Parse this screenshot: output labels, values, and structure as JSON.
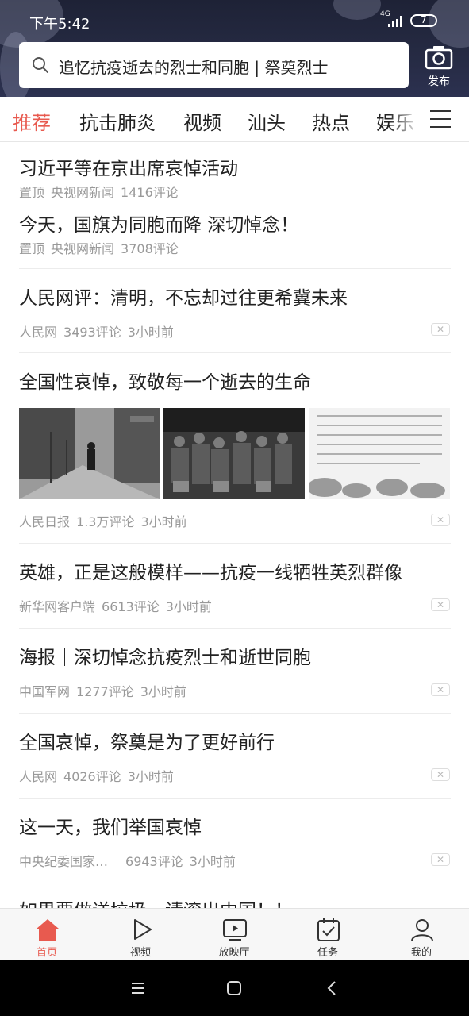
{
  "status_bar": {
    "time": "下午5:42",
    "network": "4G",
    "battery": "7"
  },
  "search": {
    "text": "追忆抗疫逝去的烈士和同胞 | 祭奠烈士",
    "publish_label": "发布"
  },
  "tabs": [
    {
      "label": "推荐",
      "active": true
    },
    {
      "label": "抗击肺炎",
      "active": false
    },
    {
      "label": "视频",
      "active": false
    },
    {
      "label": "汕头",
      "active": false
    },
    {
      "label": "热点",
      "active": false
    },
    {
      "label": "娱乐",
      "active": false
    }
  ],
  "pinned": [
    {
      "title": "习近平等在京出席哀悼活动",
      "tag": "置顶",
      "source": "央视网新闻",
      "comments": "1416评论"
    },
    {
      "title": "今天，国旗为同胞而降 深切悼念！",
      "tag": "置顶",
      "source": "央视网新闻",
      "comments": "3708评论"
    }
  ],
  "feed": [
    {
      "title": "人民网评：清明，不忘却过往更希冀未来",
      "source": "人民网",
      "comments": "3493评论",
      "time": "3小时前"
    },
    {
      "title": "全国性哀悼，致敬每一个逝去的生命",
      "source": "人民日报",
      "comments": "1.3万评论",
      "time": "3小时前"
    },
    {
      "title": "英雄，正是这般模样——抗疫一线牺牲英烈群像",
      "source": "新华网客户端",
      "comments": "6613评论",
      "time": "3小时前"
    },
    {
      "title": "海报｜深切悼念抗疫烈士和逝世同胞",
      "source": "中国军网",
      "comments": "1277评论",
      "time": "3小时前"
    },
    {
      "title": "全国哀悼，祭奠是为了更好前行",
      "source": "人民网",
      "comments": "4026评论",
      "time": "3小时前"
    },
    {
      "title": "这一天，我们举国哀悼",
      "source": "中央纪委国家…",
      "comments": "6943评论",
      "time": "3小时前"
    },
    {
      "title": "如果要做送垃圾，请滚出中国！！"
    }
  ],
  "bottom_nav": [
    {
      "label": "首页",
      "icon": "home-icon",
      "active": true
    },
    {
      "label": "视频",
      "icon": "play-icon",
      "active": false
    },
    {
      "label": "放映厅",
      "icon": "tv-icon",
      "active": false
    },
    {
      "label": "任务",
      "icon": "task-icon",
      "active": false
    },
    {
      "label": "我的",
      "icon": "user-icon",
      "active": false
    }
  ],
  "colors": {
    "accent": "#e85a4f",
    "header_bg": "#262b44",
    "meta_text": "#999999"
  }
}
